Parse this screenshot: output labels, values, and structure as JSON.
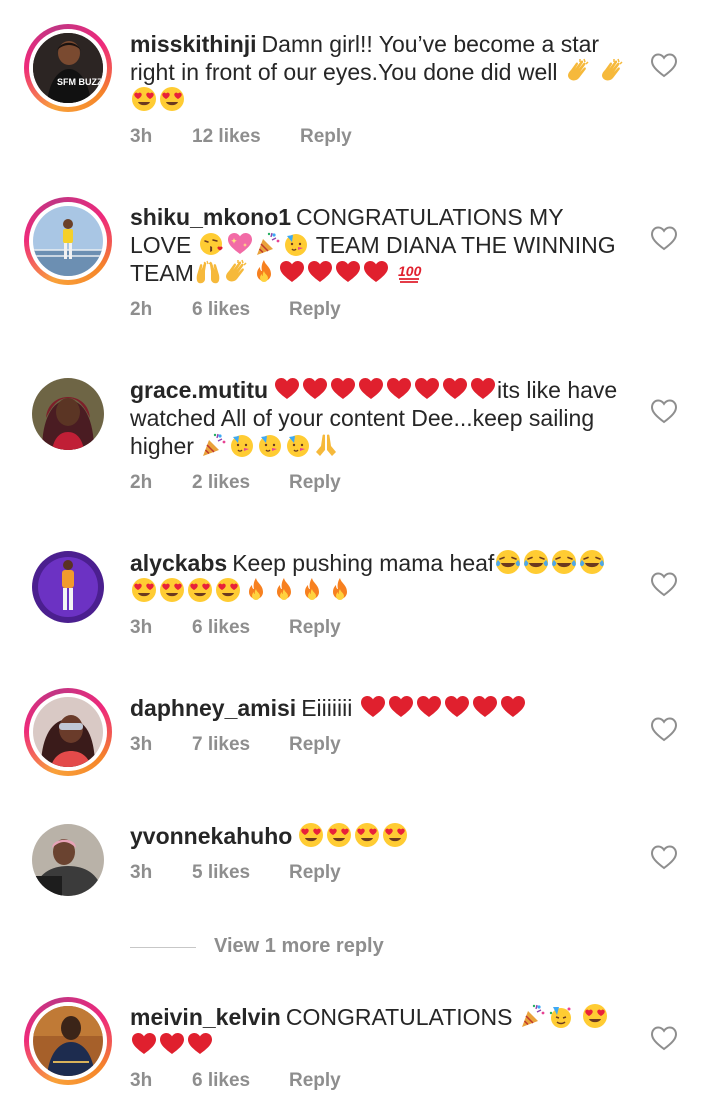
{
  "comments": [
    {
      "username": "misskithinji",
      "text": "Damn girl!! You’ve become a star right in front of our eyes.You done did well",
      "time": "3h",
      "likes": "12 likes",
      "reply": "Reply",
      "emojis": [
        "clap",
        "clap",
        "heart-eyes",
        "heart-eyes"
      ],
      "avatar_text": "SFM BUZZ"
    },
    {
      "username": "shiku_mkono1",
      "text": "CONGRATULATIONS MY LOVE",
      "text2": "TEAM DIANA THE WINNING TEAM",
      "time": "2h",
      "likes": "6 likes",
      "reply": "Reply",
      "emojis": [
        "kiss",
        "sparkle-heart",
        "party-popper",
        "party-face",
        "raised-hands",
        "clap",
        "fire",
        "red-heart",
        "red-heart",
        "red-heart",
        "red-heart",
        "hundred"
      ]
    },
    {
      "username": "grace.mutitu",
      "text": "its like have watched All of your content Dee...keep sailing higher",
      "time": "2h",
      "likes": "2 likes",
      "reply": "Reply",
      "emojis": [
        "red-heart",
        "red-heart",
        "red-heart",
        "red-heart",
        "red-heart",
        "red-heart",
        "red-heart",
        "red-heart",
        "party-popper",
        "party-face",
        "party-face",
        "party-face",
        "pray"
      ]
    },
    {
      "username": "alyckabs",
      "text": "Keep pushing mama heaf",
      "time": "3h",
      "likes": "6 likes",
      "reply": "Reply",
      "emojis": [
        "joy",
        "joy",
        "joy",
        "joy",
        "heart-eyes",
        "heart-eyes",
        "heart-eyes",
        "heart-eyes",
        "fire",
        "fire",
        "fire",
        "fire"
      ]
    },
    {
      "username": "daphney_amisi",
      "text": "Eiiiiiii",
      "time": "3h",
      "likes": "7 likes",
      "reply": "Reply",
      "emojis": [
        "red-heart",
        "red-heart",
        "red-heart",
        "red-heart",
        "red-heart",
        "red-heart"
      ]
    },
    {
      "username": "yvonnekahuho",
      "text": "",
      "time": "3h",
      "likes": "5 likes",
      "reply": "Reply",
      "emojis": [
        "heart-eyes",
        "heart-eyes",
        "heart-eyes",
        "heart-eyes"
      ]
    },
    {
      "username": "meivin_kelvin",
      "text": "CONGRATULATIONS",
      "time": "3h",
      "likes": "6 likes",
      "reply": "Reply",
      "emojis": [
        "party-popper",
        "party-face-2",
        "heart-eyes",
        "red-heart",
        "red-heart",
        "red-heart"
      ]
    }
  ],
  "view_more_replies": "View 1 more reply",
  "colors": {
    "text": "#262626",
    "meta": "#8e8e8e",
    "ring_start": "#f9a13a",
    "ring_end": "#c13584"
  },
  "icons": {
    "like": "heart-outline-icon"
  }
}
